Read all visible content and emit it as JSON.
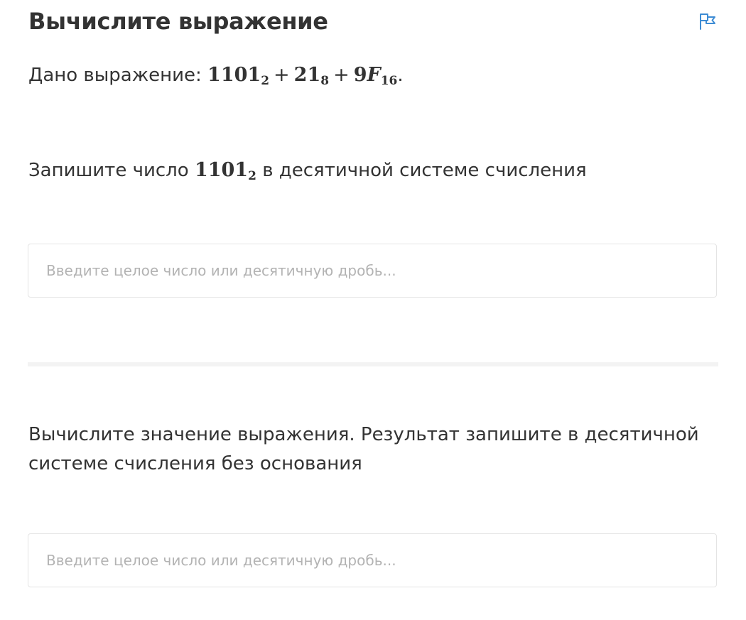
{
  "header": {
    "title": "Вычислите выражение",
    "flag_icon": "flag-icon",
    "accent_color": "#3e8cd4"
  },
  "given": {
    "prefix": "Дано выражение:",
    "terms": [
      {
        "base": "1101",
        "sub": "2"
      },
      {
        "base": "21",
        "sub": "8"
      },
      {
        "base": "9",
        "italic": "F",
        "sub": "16"
      }
    ],
    "plus": "+",
    "suffix": "."
  },
  "question1": {
    "prefix": "Запишите число",
    "term": {
      "base": "1101",
      "sub": "2"
    },
    "suffix": "в десятичной системе счисления",
    "input": {
      "value": "",
      "placeholder": "Введите целое число или десятичную дробь..."
    }
  },
  "question2": {
    "text": "Вычислите значение выражения. Результат запишите в десятичной системе счисления без основания",
    "input": {
      "value": "",
      "placeholder": "Введите целое число или десятичную дробь..."
    }
  }
}
